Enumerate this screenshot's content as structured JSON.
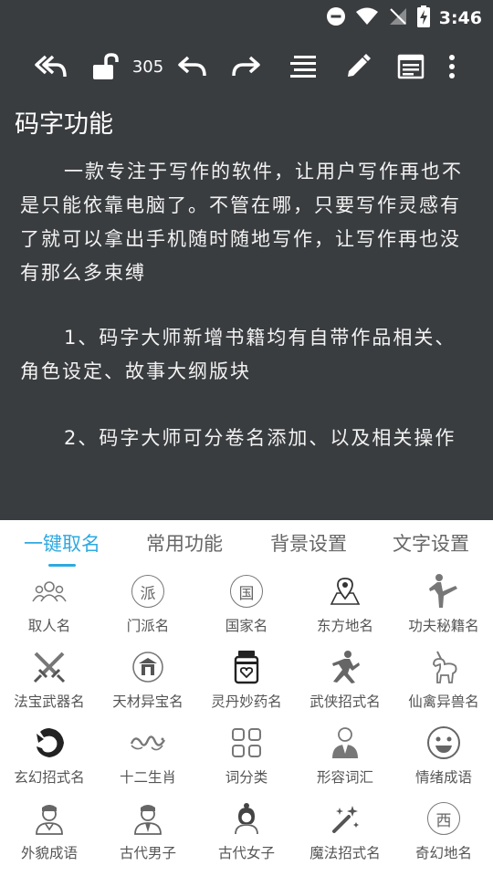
{
  "status_bar": {
    "time": "3:46"
  },
  "toolbar": {
    "word_count": "305"
  },
  "document": {
    "title": "码字功能",
    "paragraphs": [
      "一款专注于写作的软件，让用户写作再也不是只能依靠电脑了。不管在哪，只要写作灵感有了就可以拿出手机随时随地写作，让写作再也没有那么多束缚",
      "1、码字大师新增书籍均有自带作品相关、角色设定、故事大纲版块",
      "2、码字大师可分卷名添加、以及相关操作"
    ]
  },
  "tabs": [
    "一键取名",
    "常用功能",
    "背景设置",
    "文字设置"
  ],
  "active_tab": "一键取名",
  "accent_color": "#2fa9e0",
  "grid": [
    {
      "label": "取人名",
      "icon": "people-group-icon"
    },
    {
      "label": "门派名",
      "icon": "sect-seal-icon",
      "glyph": "派"
    },
    {
      "label": "国家名",
      "icon": "country-seal-icon",
      "glyph": "国"
    },
    {
      "label": "东方地名",
      "icon": "map-pin-icon"
    },
    {
      "label": "功夫秘籍名",
      "icon": "kungfu-kick-icon"
    },
    {
      "label": "法宝武器名",
      "icon": "crossed-swords-icon"
    },
    {
      "label": "天材异宝名",
      "icon": "treasure-icon"
    },
    {
      "label": "灵丹妙药名",
      "icon": "medicine-bottle-icon"
    },
    {
      "label": "武侠招式名",
      "icon": "martial-arts-icon"
    },
    {
      "label": "仙禽异兽名",
      "icon": "unicorn-icon"
    },
    {
      "label": "玄幻招式名",
      "icon": "dragon-icon"
    },
    {
      "label": "十二生肖",
      "icon": "zodiac-dragon-icon"
    },
    {
      "label": "词分类",
      "icon": "grid-squares-icon"
    },
    {
      "label": "形容词汇",
      "icon": "businessman-icon"
    },
    {
      "label": "情绪成语",
      "icon": "smiley-icon"
    },
    {
      "label": "外貌成语",
      "icon": "person-avatar-icon"
    },
    {
      "label": "古代男子",
      "icon": "man-avatar-icon"
    },
    {
      "label": "古代女子",
      "icon": "woman-avatar-icon"
    },
    {
      "label": "魔法招式名",
      "icon": "magic-wand-icon"
    },
    {
      "label": "奇幻地名",
      "icon": "west-seal-icon",
      "glyph": "西"
    }
  ]
}
